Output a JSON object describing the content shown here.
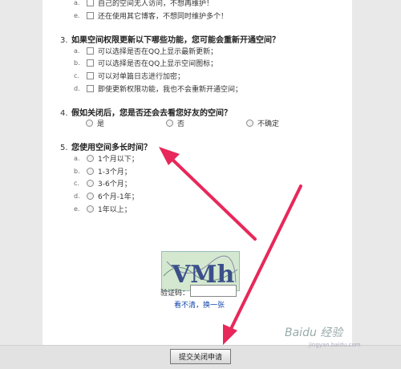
{
  "items": [
    {
      "letter": "a.",
      "label": "自己的空间无人访问，不想再维护！"
    },
    {
      "letter": "e.",
      "label": "还在使用其它博客，不想同时维护多个！"
    }
  ],
  "q3": {
    "num": "3.",
    "title": "如果空间权限更新以下哪些功能，您可能会重新开通空间？",
    "options": [
      {
        "letter": "a.",
        "label": "可以选择是否在QQ上显示最新更新；"
      },
      {
        "letter": "b.",
        "label": "可以选择是否在QQ上显示空间图标；"
      },
      {
        "letter": "c.",
        "label": "可以对单篇日志进行加密；"
      },
      {
        "letter": "d.",
        "label": "即使更新权限功能，我也不会重新开通空间；"
      }
    ]
  },
  "q4": {
    "num": "4.",
    "title": "假如关闭后，您是否还会去看您好友的空间？",
    "options": [
      "是",
      "否",
      "不确定"
    ]
  },
  "q5": {
    "num": "5.",
    "title": "您使用空间多长时间？",
    "options": [
      {
        "letter": "a.",
        "label": "1个月以下；"
      },
      {
        "letter": "b.",
        "label": "1-3个月；"
      },
      {
        "letter": "c.",
        "label": "3-6个月；"
      },
      {
        "letter": "d.",
        "label": "6个月-1年；"
      },
      {
        "letter": "e.",
        "label": "1年以上；"
      }
    ]
  },
  "captcha": {
    "image_text": "VMh",
    "label": "验证码：",
    "input_value": "",
    "refresh": "看不清，换一张"
  },
  "submit_label": "提交关闭申请",
  "watermark": {
    "main": "Baidu 经验",
    "sub": "jingyan.baidu.com"
  },
  "colors": {
    "arrow": "#e8285a",
    "link": "#1144aa"
  }
}
